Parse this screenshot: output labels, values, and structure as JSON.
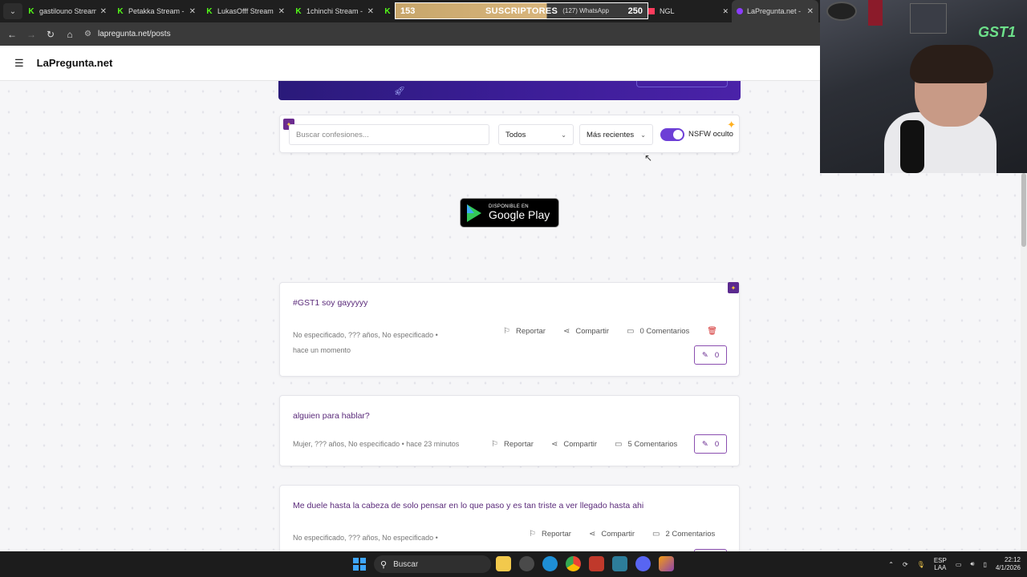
{
  "browser": {
    "tabs": [
      {
        "title": "gastilouno Stream"
      },
      {
        "title": "Petakka Stream -"
      },
      {
        "title": "LukasOfff Stream"
      },
      {
        "title": "1chinchi Stream -"
      }
    ],
    "overlay": {
      "count_left": "153",
      "label": "SUSCRIPTORES",
      "whatsapp": "(127) WhatsApp",
      "count_right": "250"
    },
    "ngl_tab": "NGL",
    "active_tab": "LaPregunta.net -",
    "url": "lapregunta.net/posts"
  },
  "site": {
    "brand": "LaPregunta.net"
  },
  "filters": {
    "search_placeholder": "Buscar confesiones...",
    "category": "Todos",
    "sort": "Más recientes",
    "nsfw_label": "NSFW oculto"
  },
  "store_badge": {
    "small": "DISPONIBLE EN",
    "big": "Google Play"
  },
  "posts": [
    {
      "title": "#GST1 soy gayyyyy",
      "meta_line1": "No especificado, ??? años, No especificado  •",
      "meta_line2": "hace un momento",
      "report": "Reportar",
      "share": "Compartir",
      "comments": "0 Comentarios",
      "votes": "0"
    },
    {
      "title": "alguien para hablar?",
      "meta_line1": "Mujer, ??? años, No especificado  •  hace 23 minutos",
      "report": "Reportar",
      "share": "Compartir",
      "comments": "5 Comentarios",
      "votes": "0"
    },
    {
      "title": "Me duele hasta la cabeza de solo pensar en lo que paso y es tan triste a ver llegado hasta ahi",
      "meta_line1": "No especificado, ??? años, No especificado  •",
      "report": "Reportar",
      "share": "Compartir",
      "comments": "2 Comentarios"
    }
  ],
  "taskbar": {
    "search": "Buscar",
    "lang1": "ESP",
    "lang2": "LAA",
    "time": "22:12",
    "date": "4/1/2026"
  },
  "colors": {
    "accent": "#6d3fd6",
    "title": "#5a2a7a",
    "banner": "#3b1d96"
  }
}
